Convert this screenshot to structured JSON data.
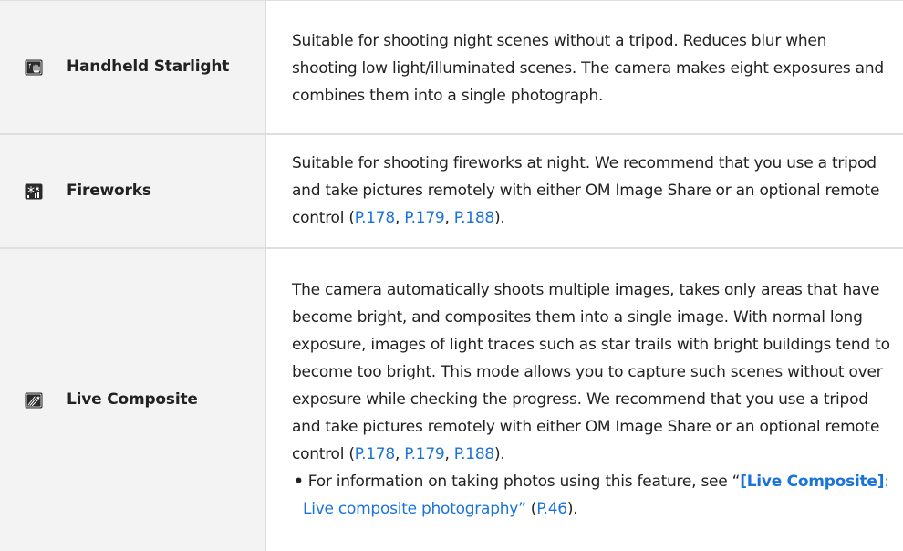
{
  "rows": [
    {
      "icon": "handheld-starlight-icon",
      "name": "Handheld Starlight",
      "description": "Suitable for shooting night scenes without a tripod. Reduces blur when shooting low light/illuminated scenes. The camera makes eight exposures and combines them into a single photograph."
    },
    {
      "icon": "fireworks-icon",
      "name": "Fireworks",
      "description": "Suitable for shooting fireworks at night. We recommend that you use a tripod and take pictures remotely with either OM Image Share or an optional remote control (",
      "refs": [
        "P.178",
        "P.179",
        "P.188"
      ],
      "sep": ", ",
      "close": ")."
    },
    {
      "icon": "live-composite-icon",
      "name": "Live Composite",
      "description": "The camera automatically shoots multiple images, takes only areas that have become bright, and composites them into a single image. With normal long exposure, images of light traces such as star trails with bright buildings tend to become too bright. This mode allows you to capture such scenes without over exposure while checking the progress. We recommend that you use a tripod and take pictures remotely with either OM Image Share or an optional remote control (",
      "refs": [
        "P.178",
        "P.179",
        "P.188"
      ],
      "sep": ", ",
      "close": ").",
      "note": {
        "bullet": "•",
        "prefix": "For information on taking photos using this feature, see “",
        "link_bold": "[Live Composite]",
        "link_text": ": Live composite photography”",
        "mid": " (",
        "page_ref": "P.46",
        "suffix": ")."
      }
    }
  ],
  "colors": {
    "text": "#222222",
    "link": "#1a73d9",
    "row_header_bg": "#f3f3f3",
    "border": "#dedede"
  }
}
